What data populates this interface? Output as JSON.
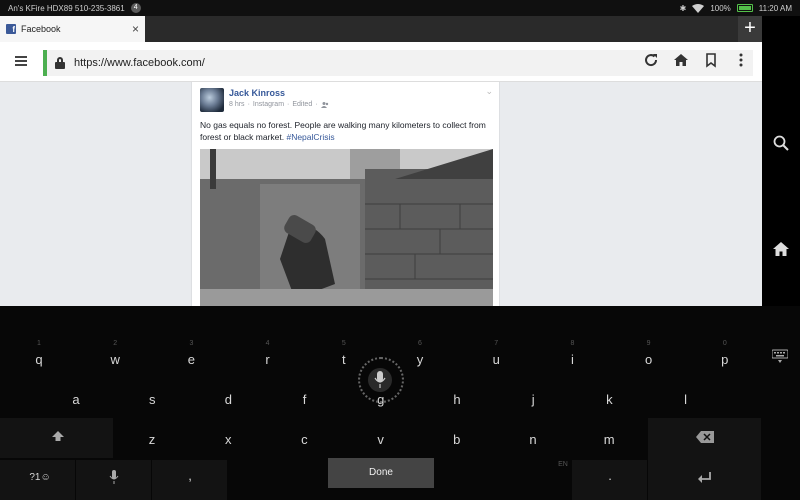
{
  "status_bar": {
    "device_label": "An's KFire HDX89 510-235-3861",
    "notification_count": "4",
    "battery": "100%",
    "time": "11:20 AM"
  },
  "tab": {
    "title": "Facebook",
    "close_glyph": "×",
    "new_tab_glyph": "+"
  },
  "address_bar": {
    "url": "https://www.facebook.com/"
  },
  "post": {
    "author": "Jack Kinross",
    "time": "8 hrs",
    "source": "Instagram",
    "edited": "Edited",
    "sep": "·",
    "text": "No gas equals no forest. People are walking many kilometers to collect from forest or black market.",
    "hashtag": "#NepalCrisis"
  },
  "keyboard": {
    "row1": [
      "q",
      "w",
      "e",
      "r",
      "t",
      "y",
      "u",
      "i",
      "o",
      "p"
    ],
    "row1_hints": [
      "1",
      "2",
      "3",
      "4",
      "5",
      "6",
      "7",
      "8",
      "9",
      "0"
    ],
    "row2": [
      "a",
      "s",
      "d",
      "f",
      "g",
      "h",
      "j",
      "k",
      "l"
    ],
    "row3": [
      "z",
      "x",
      "c",
      "v",
      "b",
      "n",
      "m"
    ],
    "symbols_label": "?1☺",
    "comma": ",",
    "period": ".",
    "lang": "EN",
    "done_label": "Done"
  },
  "colors": {
    "fb_blue": "#3b5998",
    "link_blue": "#365899",
    "secure_green": "#4caf50",
    "battery_green": "#54c04a"
  }
}
